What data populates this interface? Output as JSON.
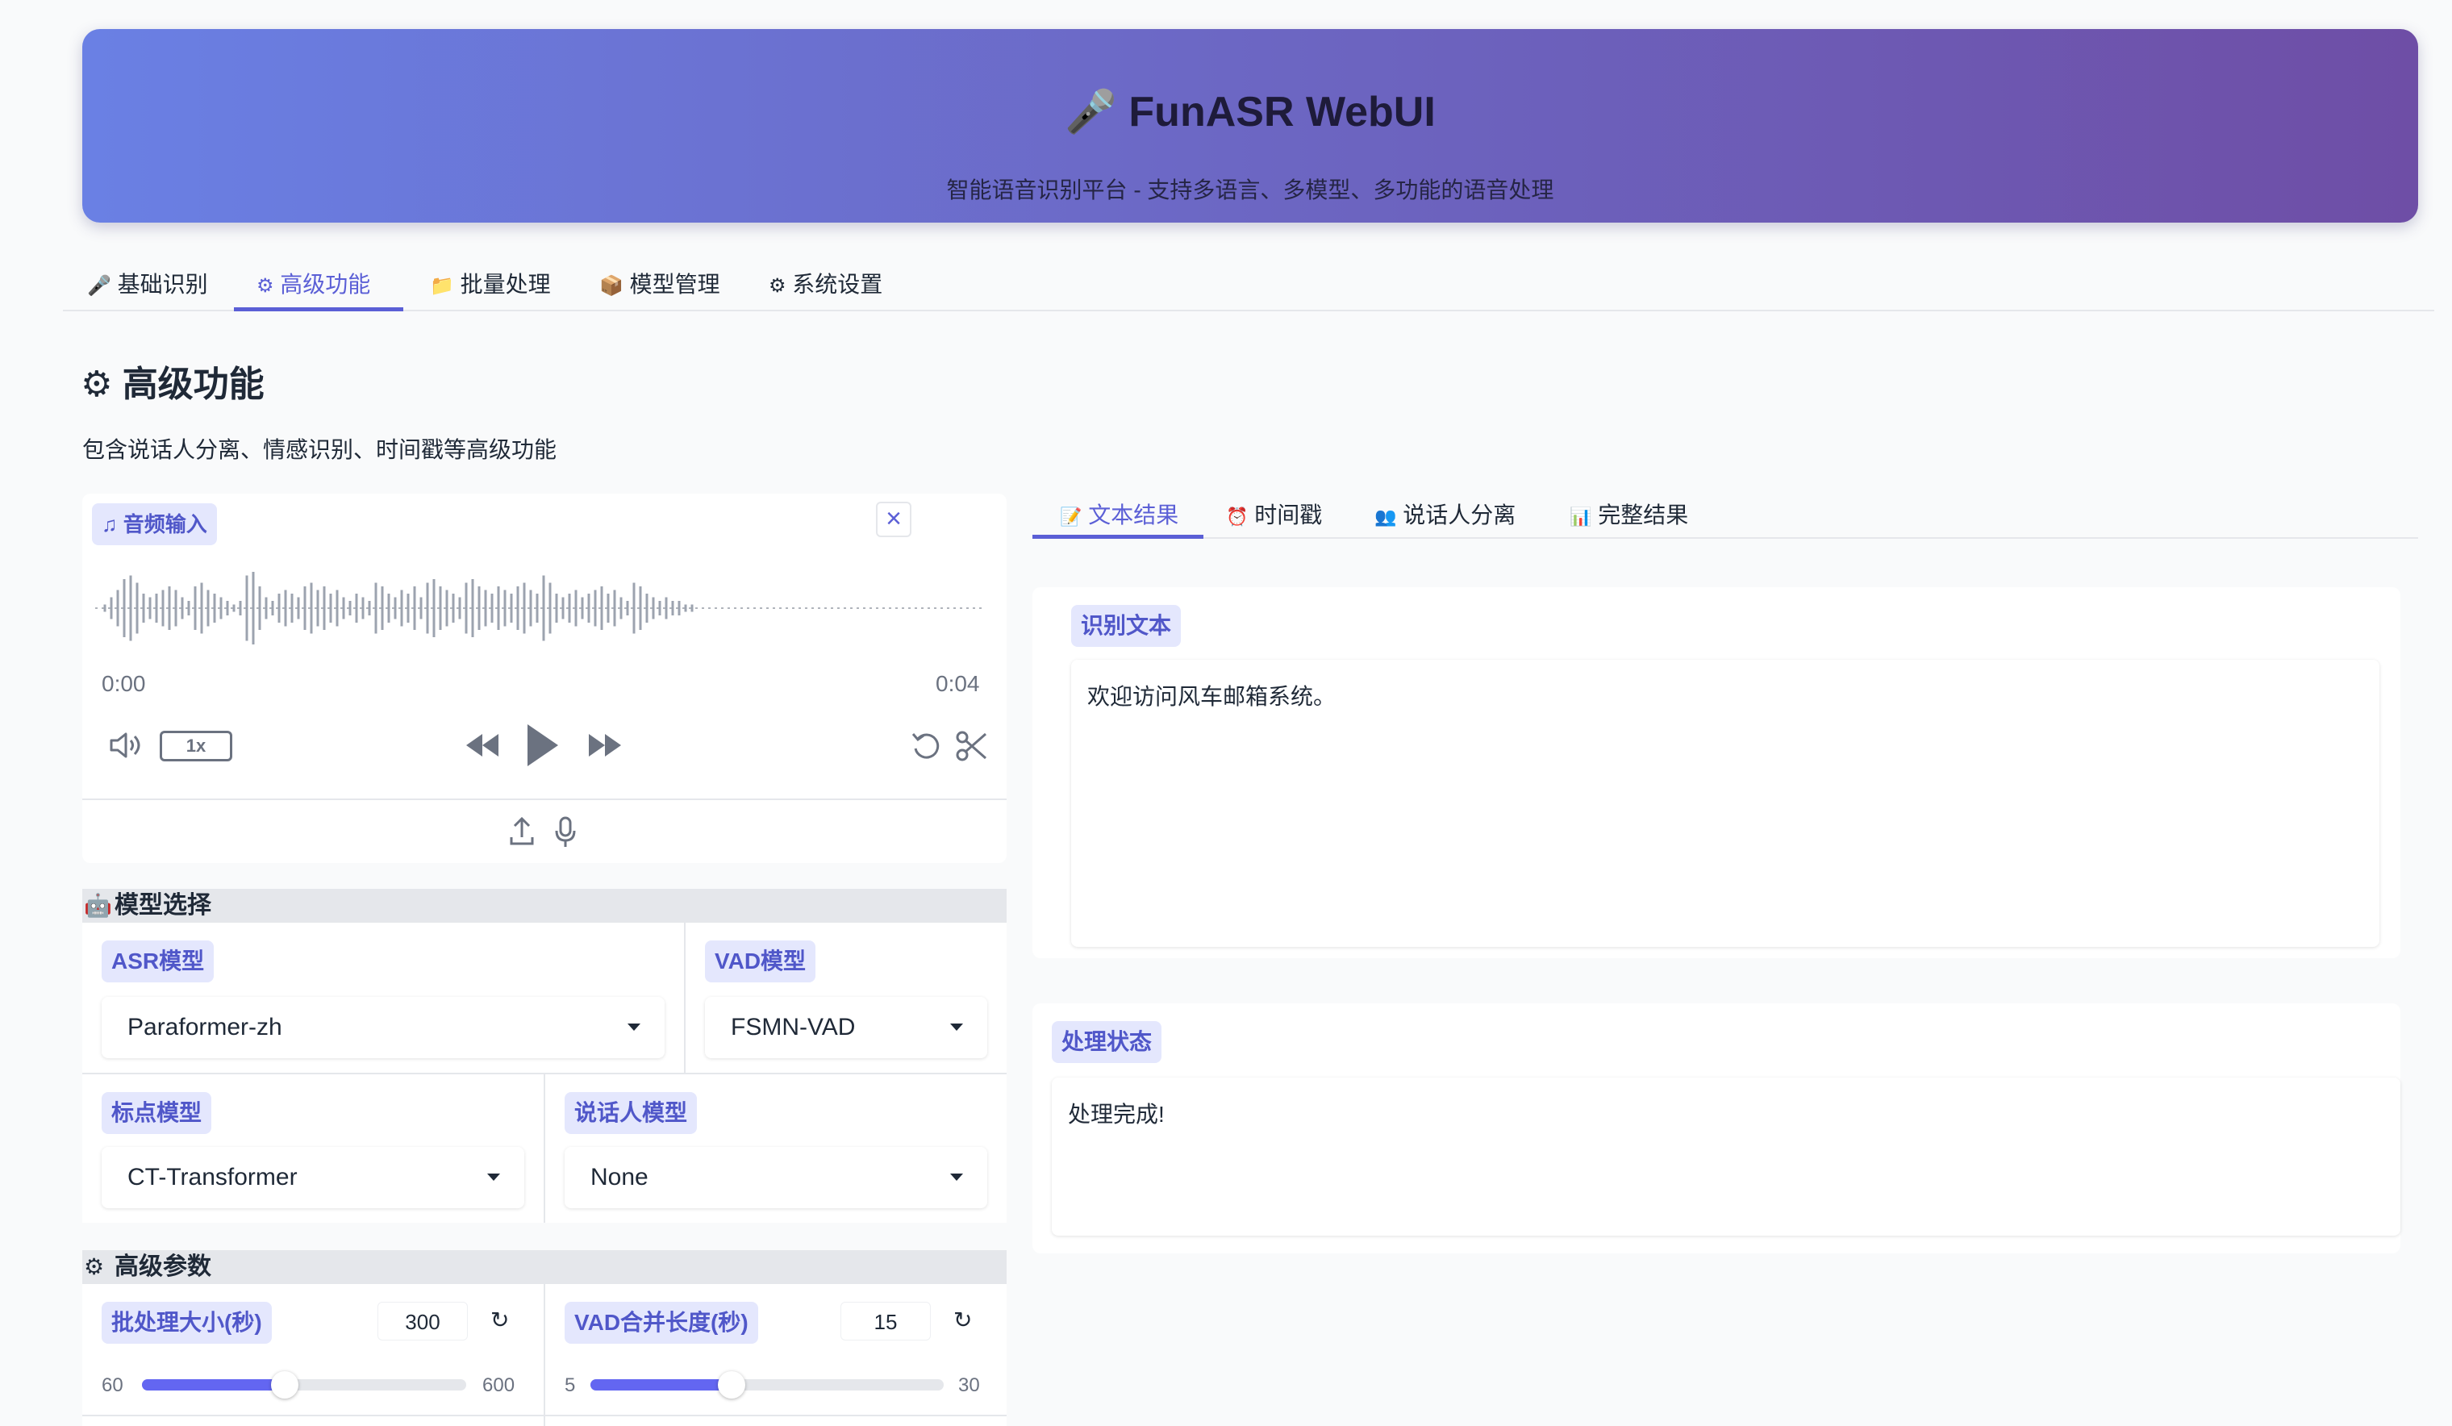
{
  "header": {
    "title": "FunASR WebUI",
    "subtitle": "智能语音识别平台 - 支持多语言、多模型、多功能的语音处理"
  },
  "tabs": [
    {
      "label": "基础识别",
      "icon": "microphone-icon"
    },
    {
      "label": "高级功能",
      "icon": "gear-icon",
      "active": true
    },
    {
      "label": "批量处理",
      "icon": "folder-icon"
    },
    {
      "label": "模型管理",
      "icon": "package-icon"
    },
    {
      "label": "系统设置",
      "icon": "gear-icon"
    }
  ],
  "section": {
    "title": "高级功能",
    "description": "包含说话人分离、情感识别、时间戳等高级功能"
  },
  "audio": {
    "label": "音频输入",
    "time_start": "0:00",
    "time_end": "0:04",
    "speed": "1x"
  },
  "model_select": {
    "title": "模型选择",
    "asr_label": "ASR模型",
    "asr_value": "Paraformer-zh",
    "vad_label": "VAD模型",
    "vad_value": "FSMN-VAD",
    "punc_label": "标点模型",
    "punc_value": "CT-Transformer",
    "spk_label": "说话人模型",
    "spk_value": "None"
  },
  "advanced": {
    "title": "高级参数",
    "batch": {
      "label": "批处理大小(秒)",
      "value": "300",
      "min": "60",
      "max": "600",
      "fraction": 0.44
    },
    "vad_merge": {
      "label": "VAD合并长度(秒)",
      "value": "15",
      "min": "5",
      "max": "30",
      "fraction": 0.4
    }
  },
  "result_tabs": [
    {
      "label": "文本结果",
      "icon": "memo-icon",
      "active": true
    },
    {
      "label": "时间戳",
      "icon": "alarm-clock-icon"
    },
    {
      "label": "说话人分离",
      "icon": "people-icon"
    },
    {
      "label": "完整结果",
      "icon": "bar-chart-icon"
    }
  ],
  "result": {
    "text_label": "识别文本",
    "text_value": "欢迎访问风车邮箱系统。",
    "status_label": "处理状态",
    "status_value": "处理完成!"
  },
  "colors": {
    "accent": "#5b5fd6",
    "chip_bg": "#e4e7fd",
    "slider": "#6366f1"
  }
}
